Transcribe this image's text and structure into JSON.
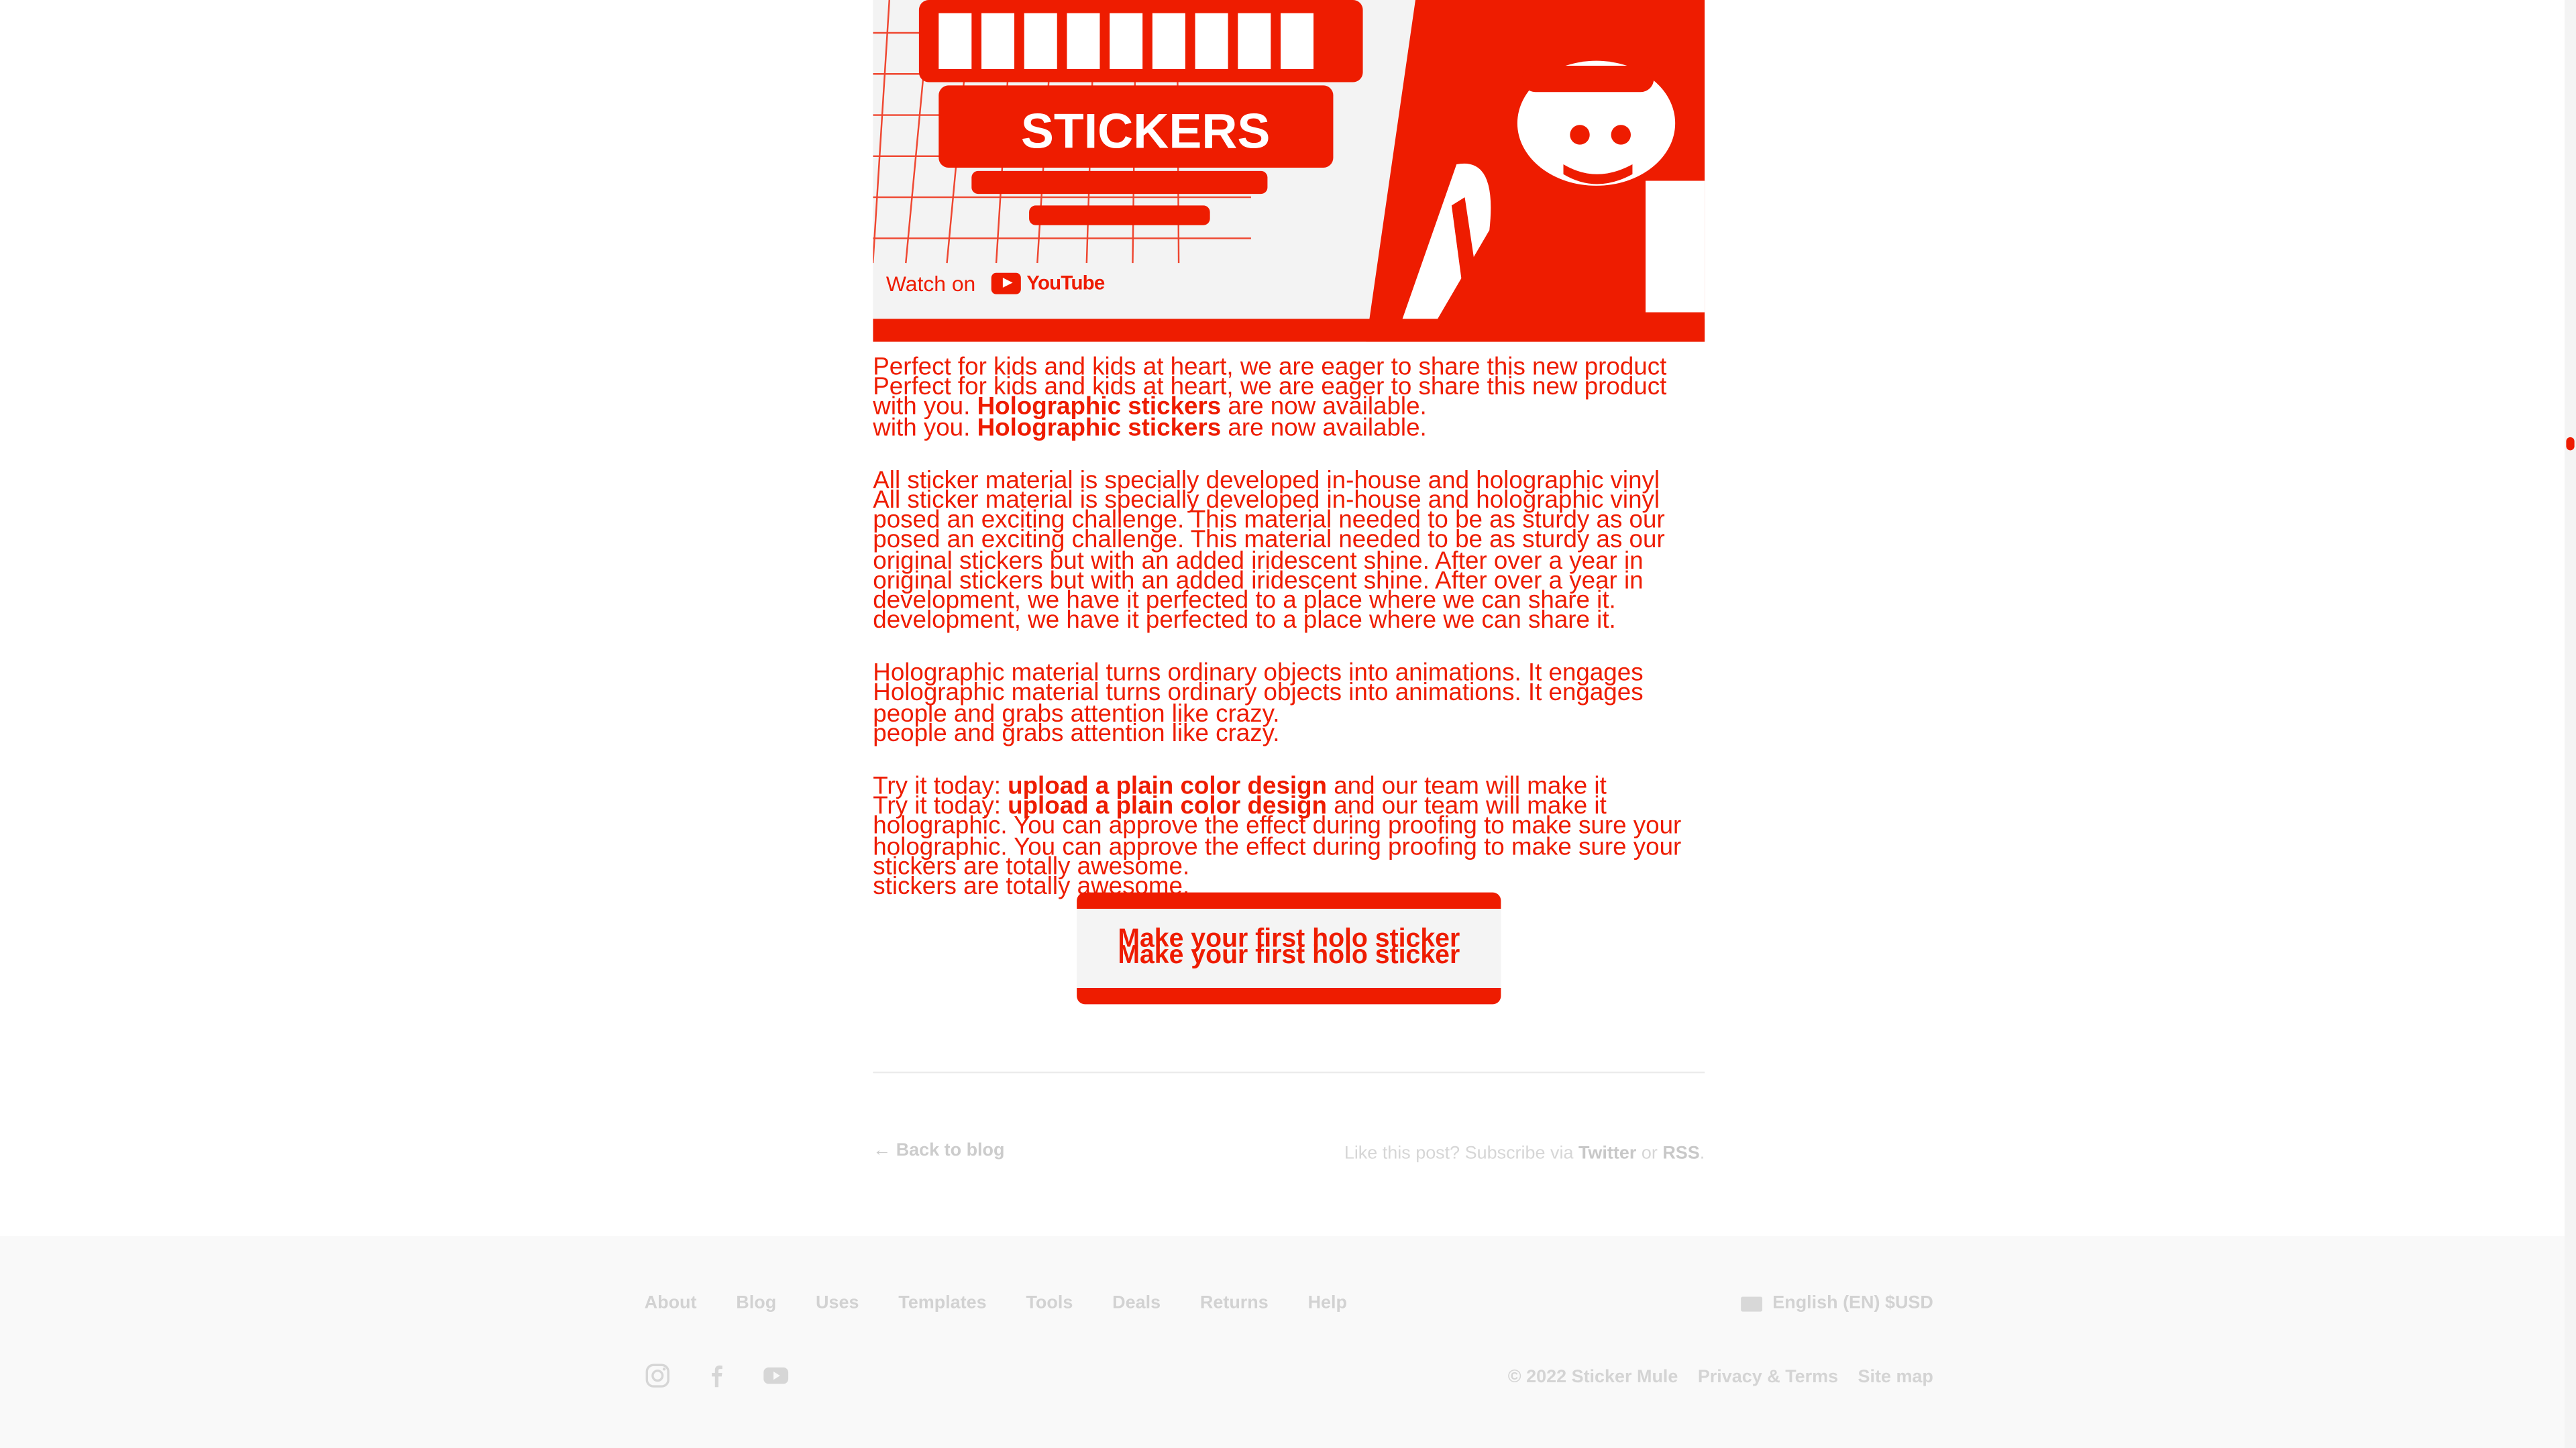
{
  "video": {
    "watch_on_label": "Watch on",
    "youtube_label": "YouTube",
    "sticker_logo_text": "STICKERS"
  },
  "article": {
    "p1": {
      "l1": "Perfect for kids and kids at heart, we are eager to share this new product",
      "l2_pre": "with you. ",
      "l2_bold": "Holographic stickers",
      "l2_post": " are now available."
    },
    "p2": {
      "l1": "All sticker material is specially developed in-house and holographic vinyl",
      "l2": "posed an exciting challenge. This material needed to be as sturdy as our",
      "l3": "original stickers but with an added iridescent shine. After over a year in",
      "l4": "development, we have it perfected to a place where we can share it."
    },
    "p3": {
      "l1": "Holographic material turns ordinary objects into animations. It engages",
      "l2": "people and grabs attention like crazy."
    },
    "p4": {
      "l1_pre": "Try it today: ",
      "l1_bold": "upload a plain color design",
      "l1_post": " and our team will make it",
      "l2": "holographic. You can approve the effect during proofing to make sure your",
      "l3": "stickers are totally awesome."
    },
    "cta_label": "Make your first holo sticker"
  },
  "post_nav": {
    "back_label": "← Back to blog",
    "subscribe_pre": "Like this post? Subscribe via ",
    "twitter_label": "Twitter",
    "or_label": " or ",
    "rss_label": "RSS",
    "period": "."
  },
  "footer": {
    "nav": [
      "About",
      "Blog",
      "Uses",
      "Templates",
      "Tools",
      "Deals",
      "Returns",
      "Help"
    ],
    "locale_label": "English (EN) $USD",
    "copyright": "© 2022 Sticker Mule",
    "privacy_label": "Privacy & Terms",
    "sitemap_label": "Site map",
    "social_icons": [
      "instagram-icon",
      "facebook-icon",
      "youtube-icon"
    ]
  },
  "colors": {
    "accent": "#ee1c00",
    "footer_bg": "#f9f9f9",
    "muted_text": "#d2d2d2"
  }
}
